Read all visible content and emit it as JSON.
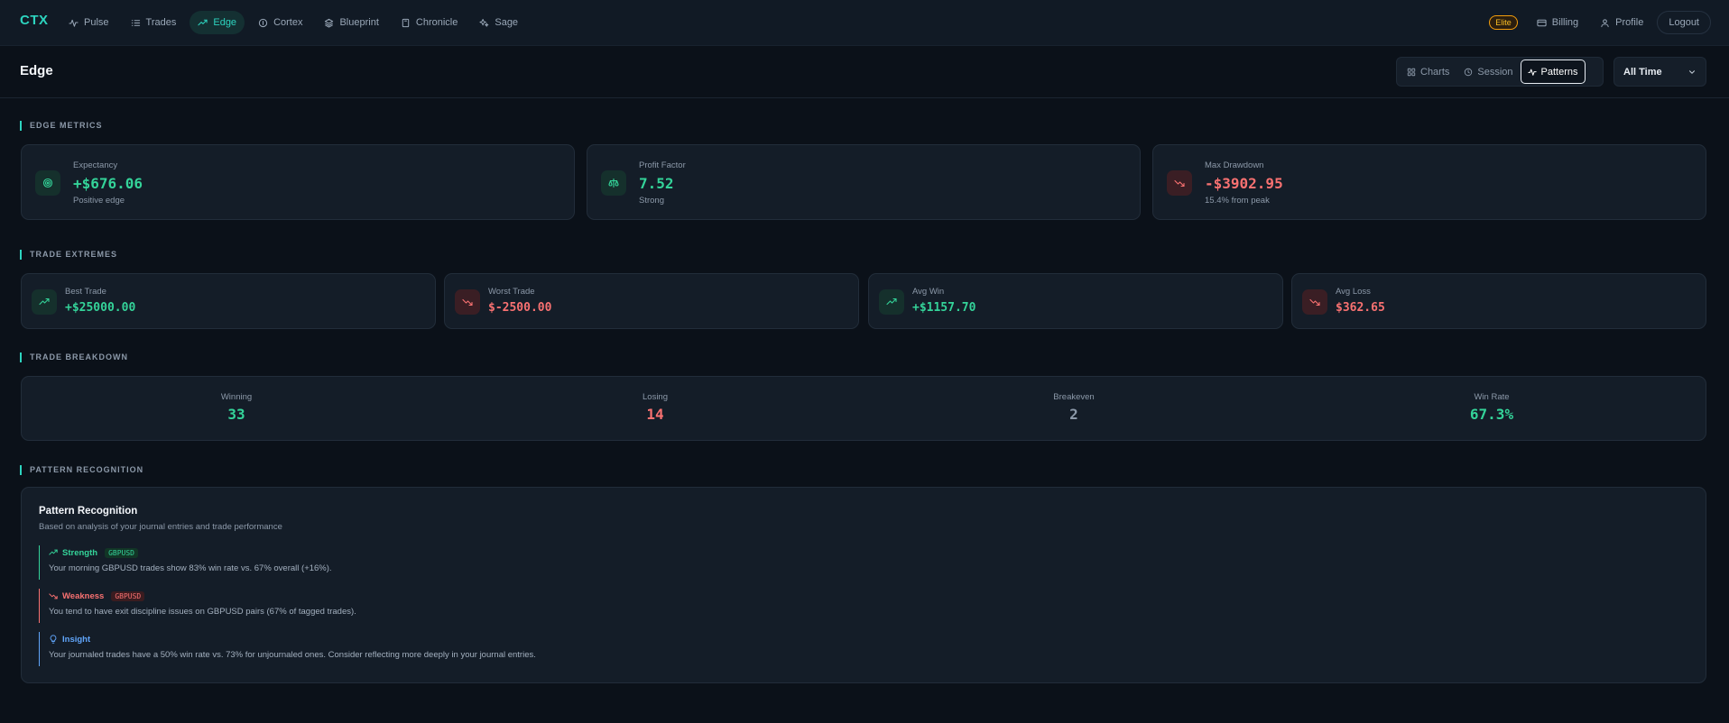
{
  "nav": {
    "brand": "CTX",
    "items": [
      {
        "label": "Pulse",
        "icon": "pulse-icon"
      },
      {
        "label": "Trades",
        "icon": "list-icon"
      },
      {
        "label": "Edge",
        "icon": "trending-up-icon",
        "active": true
      },
      {
        "label": "Cortex",
        "icon": "info-icon"
      },
      {
        "label": "Blueprint",
        "icon": "layers-icon"
      },
      {
        "label": "Chronicle",
        "icon": "book-icon"
      },
      {
        "label": "Sage",
        "icon": "sparkles-icon"
      }
    ],
    "plan_badge": "Elite",
    "billing": "Billing",
    "profile": "Profile",
    "logout": "Logout"
  },
  "header": {
    "title": "Edge",
    "tabs": [
      {
        "label": "Charts",
        "icon": "grid-icon"
      },
      {
        "label": "Session",
        "icon": "clock-icon"
      },
      {
        "label": "Patterns",
        "icon": "activity-icon",
        "active": true
      }
    ],
    "range": "All Time"
  },
  "edge_metrics": {
    "section": "EDGE METRICS",
    "expectancy": {
      "label": "Expectancy",
      "value": "+$676.06",
      "sub": "Positive edge"
    },
    "profit_factor": {
      "label": "Profit Factor",
      "value": "7.52",
      "sub": "Strong"
    },
    "max_drawdown": {
      "label": "Max Drawdown",
      "value": "-$3902.95",
      "sub": "15.4% from peak"
    }
  },
  "trade_extremes": {
    "section": "TRADE EXTREMES",
    "best": {
      "label": "Best Trade",
      "value": "+$25000.00"
    },
    "worst": {
      "label": "Worst Trade",
      "value": "$-2500.00"
    },
    "avg_win": {
      "label": "Avg Win",
      "value": "+$1157.70"
    },
    "avg_loss": {
      "label": "Avg Loss",
      "value": "$362.65"
    }
  },
  "trade_breakdown": {
    "section": "TRADE BREAKDOWN",
    "winning": {
      "label": "Winning",
      "value": "33"
    },
    "losing": {
      "label": "Losing",
      "value": "14"
    },
    "breakeven": {
      "label": "Breakeven",
      "value": "2"
    },
    "win_rate": {
      "label": "Win Rate",
      "value": "67.3%"
    }
  },
  "patterns": {
    "section": "PATTERN RECOGNITION",
    "title": "Pattern Recognition",
    "subtitle": "Based on analysis of your journal entries and trade performance",
    "strength": {
      "label": "Strength",
      "tag": "GBPUSD",
      "text": "Your morning GBPUSD trades show 83% win rate vs. 67% overall (+16%)."
    },
    "weakness": {
      "label": "Weakness",
      "tag": "GBPUSD",
      "text": "You tend to have exit discipline issues on GBPUSD pairs (67% of tagged trades)."
    },
    "insight": {
      "label": "Insight",
      "text": "Your journaled trades have a 50% win rate vs. 73% for unjournaled ones. Consider reflecting more deeply in your journal entries."
    }
  },
  "colors": {
    "accent": "#2dd4bf",
    "positive": "#34d399",
    "negative": "#f87171",
    "warning": "#f59e0b",
    "info": "#60a5fa"
  }
}
